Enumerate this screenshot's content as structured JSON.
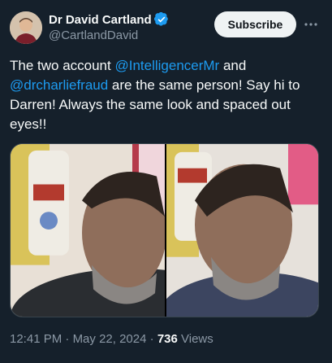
{
  "author": {
    "display_name": "Dr David Cartland",
    "handle": "@CartlandDavid",
    "verified": true
  },
  "actions": {
    "subscribe_label": "Subscribe"
  },
  "tweet": {
    "text_prefix": "The two account ",
    "mention_1": "@IntelligencerMr",
    "text_mid": " and ",
    "mention_2": "@drcharliefraud",
    "text_suffix": " are the same person! Say hi to Darren! Always the same look and spaced out eyes!!"
  },
  "meta": {
    "time": "12:41 PM",
    "separator": "·",
    "date": "May 22, 2024",
    "views_count": "736",
    "views_label": "Views"
  },
  "colors": {
    "background": "#15202b",
    "accent": "#1d9bf0",
    "secondary_text": "#8b98a5"
  }
}
